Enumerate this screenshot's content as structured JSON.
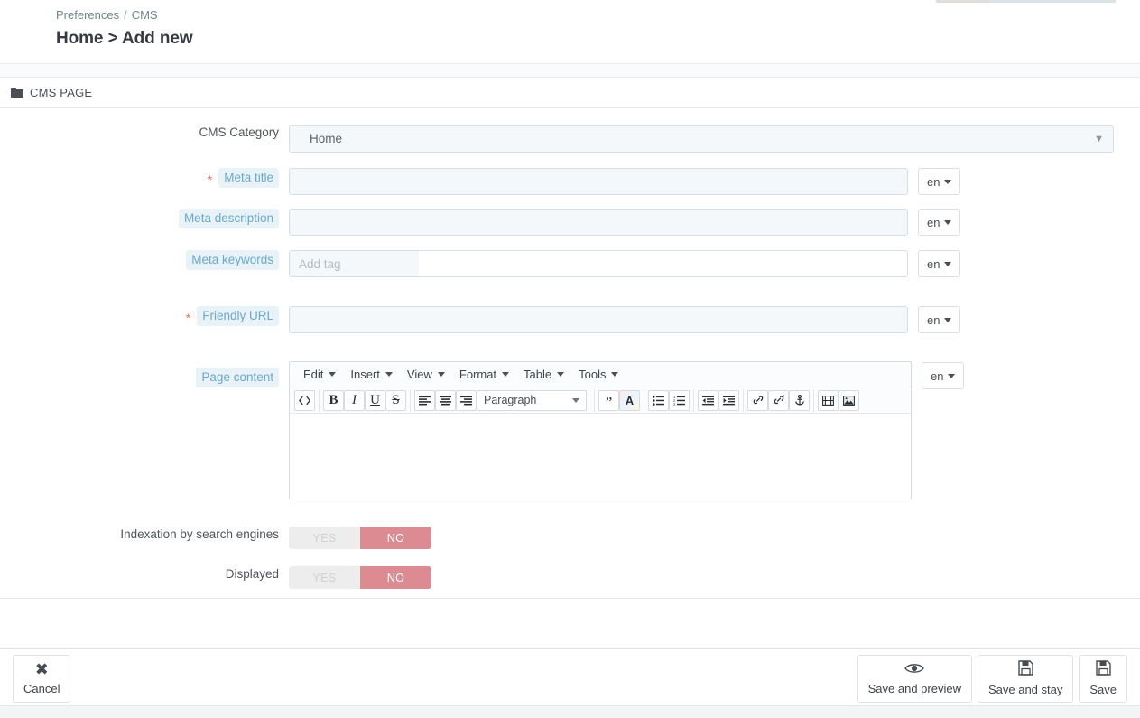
{
  "breadcrumb": {
    "parent": "Preferences",
    "separator": "/",
    "current": "CMS"
  },
  "page_title": "Home > Add new",
  "panel": {
    "title": "CMS PAGE",
    "icon": "folder-icon"
  },
  "form": {
    "category": {
      "label": "CMS Category",
      "value": "Home",
      "options": [
        "Home"
      ]
    },
    "meta_title": {
      "label": "Meta title",
      "required_marker": "*",
      "value": "",
      "placeholder": "",
      "lang": "en"
    },
    "meta_description": {
      "label": "Meta description",
      "value": "",
      "placeholder": "",
      "lang": "en"
    },
    "meta_keywords": {
      "label": "Meta keywords",
      "value": "",
      "placeholder": "Add tag",
      "lang": "en"
    },
    "friendly_url": {
      "label": "Friendly URL",
      "required_marker": "*",
      "value": "",
      "placeholder": "",
      "lang": "en"
    },
    "page_content": {
      "label": "Page content",
      "lang": "en",
      "value": ""
    },
    "indexation": {
      "label": "Indexation by search engines",
      "yes_label": "YES",
      "no_label": "NO",
      "selected": "NO"
    },
    "displayed": {
      "label": "Displayed",
      "yes_label": "YES",
      "no_label": "NO",
      "selected": "NO"
    }
  },
  "editor": {
    "menus": [
      {
        "label": "Edit",
        "name": "edit"
      },
      {
        "label": "Insert",
        "name": "insert"
      },
      {
        "label": "View",
        "name": "view"
      },
      {
        "label": "Format",
        "name": "format"
      },
      {
        "label": "Table",
        "name": "table"
      },
      {
        "label": "Tools",
        "name": "tools"
      }
    ],
    "format_select": "Paragraph",
    "tools": {
      "source_code": "</>",
      "bold": "B",
      "italic": "I",
      "underline": "U",
      "strikethrough": "S",
      "align_left": "≡",
      "align_center": "≡",
      "align_right": "≡",
      "blockquote": "❞",
      "text_color": "A",
      "bullet_list": "•",
      "numbered_list": "1.",
      "outdent": "⇤",
      "indent": "⇥",
      "link": "🔗",
      "unlink": "⛓",
      "anchor": "⚓",
      "media": "▦",
      "image": "🖼"
    }
  },
  "footer": {
    "cancel": {
      "label": "Cancel",
      "icon": "close-icon",
      "glyph": "✖"
    },
    "save_and_preview": {
      "label": "Save and preview",
      "icon": "eye-icon",
      "glyph": "👁"
    },
    "save_and_stay": {
      "label": "Save and stay",
      "icon": "floppy-icon",
      "glyph": "🖫"
    },
    "save": {
      "label": "Save",
      "icon": "floppy-icon",
      "glyph": "🖫"
    }
  },
  "colors": {
    "label_pill_bg": "#e8f2f7",
    "label_pill_text": "#6aa8cc",
    "required": "#fa6b6b",
    "input_bg": "#f4f8fa",
    "switch_on": "#dc8b92",
    "switch_off": "#ededed"
  }
}
